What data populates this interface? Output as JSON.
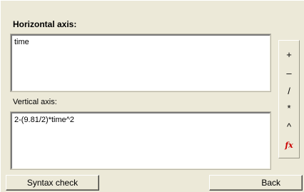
{
  "horizontal": {
    "label": "Horizontal axis:",
    "value": "time"
  },
  "vertical": {
    "label": "Vertical axis:",
    "value": "2-(9.81/2)*time^2"
  },
  "operators": {
    "plus": "+",
    "minus": "–",
    "divide": "/",
    "multiply": "*",
    "power": "^",
    "function": "fx"
  },
  "buttons": {
    "syntax_check": "Syntax check",
    "back": "Back"
  },
  "colors": {
    "background": "#ece9d8",
    "function_icon": "#cc0000"
  }
}
